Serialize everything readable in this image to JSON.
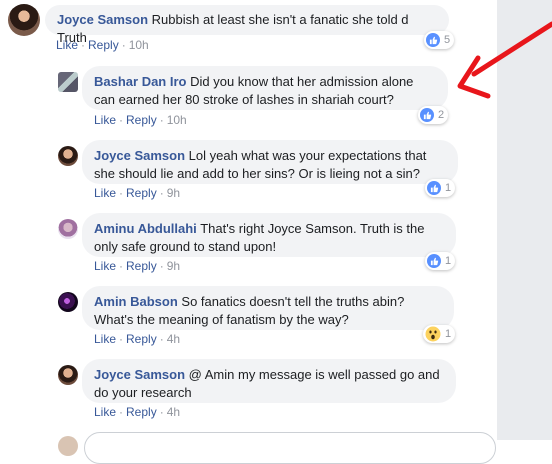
{
  "top_comment": {
    "author": "Joyce Samson",
    "text": "Rubbish at least she isn't a fanatic she told d Truth",
    "like_label": "Like",
    "reply_label": "Reply",
    "time": "10h",
    "reaction_count": "5"
  },
  "replies": [
    {
      "author": "Bashar Dan Iro",
      "text": "Did you know that her admission alone can earned her 80 stroke of lashes in shariah court?",
      "like_label": "Like",
      "reply_label": "Reply",
      "time": "10h",
      "reaction_count": "2",
      "reaction": "like-icon"
    },
    {
      "author": "Joyce Samson",
      "text": "Lol yeah what was your expectations that she should lie and add to her sins? Or is lieing not a sin?",
      "like_label": "Like",
      "reply_label": "Reply",
      "time": "9h",
      "reaction_count": "1",
      "reaction": "like-icon"
    },
    {
      "author": "Aminu Abdullahi",
      "text": "That's right Joyce Samson. Truth is the only safe ground to stand upon!",
      "like_label": "Like",
      "reply_label": "Reply",
      "time": "9h",
      "reaction_count": "1",
      "reaction": "like-icon"
    },
    {
      "author": "Amin Babson",
      "text": "So fanatics doesn't tell the truths abin? What's the meaning of fanatism by the way?",
      "like_label": "Like",
      "reply_label": "Reply",
      "time": "4h",
      "reaction_count": "1",
      "reaction": "wow-icon"
    },
    {
      "author": "Joyce Samson",
      "text": "@ Amin my message is well passed go and do your research",
      "like_label": "Like",
      "reply_label": "Reply",
      "time": "4h",
      "reaction_count": "",
      "reaction": ""
    }
  ],
  "colors": {
    "link": "#385898",
    "bubble": "#f2f3f5",
    "meta": "#90949c",
    "like_blue": "#5890ff",
    "annotation_arrow": "#e8161b"
  }
}
